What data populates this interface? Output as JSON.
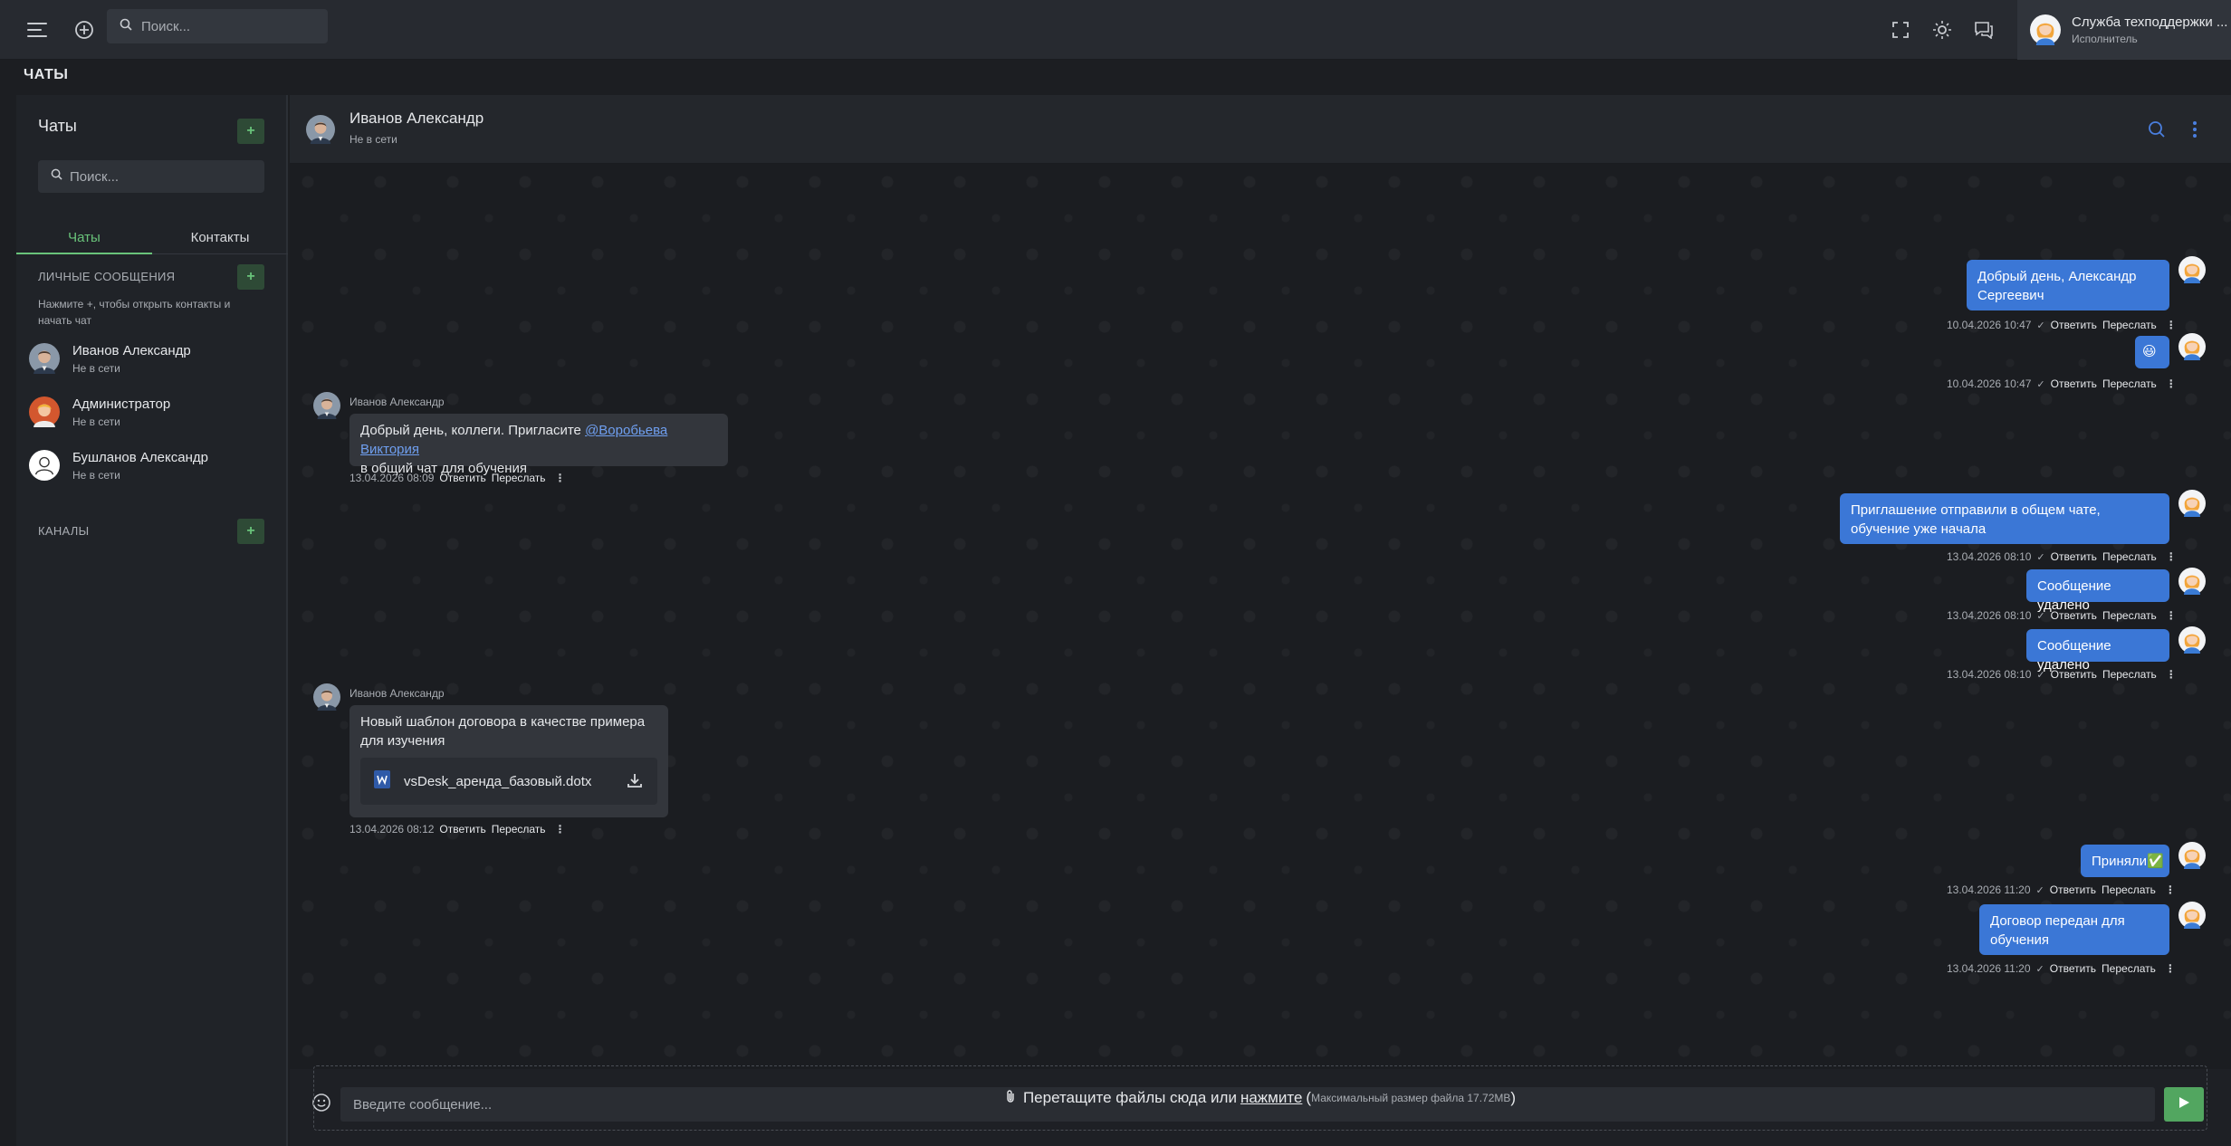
{
  "topbar": {
    "search_placeholder": "Поиск...",
    "user_name": "Служба техподдержки ...",
    "user_role": "Исполнитель"
  },
  "page": {
    "title": "ЧАТЫ"
  },
  "sidebar": {
    "title": "Чаты",
    "search_placeholder": "Поиск...",
    "tabs": [
      {
        "label": "Чаты",
        "active": true
      },
      {
        "label": "Контакты",
        "active": false
      }
    ],
    "personal_section": "ЛИЧНЫЕ СООБЩЕНИЯ",
    "hint": "Нажмите +, чтобы открыть контакты и начать чат",
    "contacts": [
      {
        "name": "Иванов Александр",
        "status": "Не в сети"
      },
      {
        "name": "Администратор",
        "status": "Не в сети"
      },
      {
        "name": "Бушланов Александр",
        "status": "Не в сети"
      }
    ],
    "channels_section": "КАНАЛЫ"
  },
  "chat": {
    "name": "Иванов Александр",
    "status": "Не в сети",
    "reply_label": "Ответить",
    "forward_label": "Переслать",
    "messages": [
      {
        "dir": "out",
        "text": "Добрый день, Александр Сергеевич",
        "time": "10.04.2026 10:47"
      },
      {
        "dir": "out",
        "text": "😃",
        "time": "10.04.2026 10:47"
      },
      {
        "dir": "in",
        "author": "Иванов Александр",
        "text_before": "Добрый день, коллеги. Пригласите ",
        "mention": "@Воробьева Виктория",
        "text_after": "в общий чат для обучения",
        "time": "13.04.2026 08:09"
      },
      {
        "dir": "out",
        "text": "Приглашение отправили в общем чате, обучение уже начала",
        "time": "13.04.2026 08:10"
      },
      {
        "dir": "out",
        "text": "Сообщение удалено",
        "time": "13.04.2026 08:10"
      },
      {
        "dir": "out",
        "text": "Сообщение удалено",
        "time": "13.04.2026 08:10"
      },
      {
        "dir": "in",
        "author": "Иванов Александр",
        "text": "Новый шаблон договора в качестве примера для изучения",
        "file": "vsDesk_аренда_базовый.dotx",
        "time": "13.04.2026 08:12"
      },
      {
        "dir": "out",
        "text": "Приняли✅",
        "time": "13.04.2026 11:20"
      },
      {
        "dir": "out",
        "text": "Договор передан для обучения",
        "time": "13.04.2026 11:20"
      }
    ]
  },
  "composer": {
    "placeholder": "Введите сообщение...",
    "drop_text": "Перетащите файлы сюда или",
    "drop_link": "нажмите",
    "drop_limit_open": "(",
    "drop_limit": "Максимальный размер файла 17.72MB",
    "drop_limit_close": ")"
  },
  "colors": {
    "accent_green": "#69c37a",
    "outgoing_bubble": "#3b77d6",
    "incoming_bubble": "#33363c"
  }
}
